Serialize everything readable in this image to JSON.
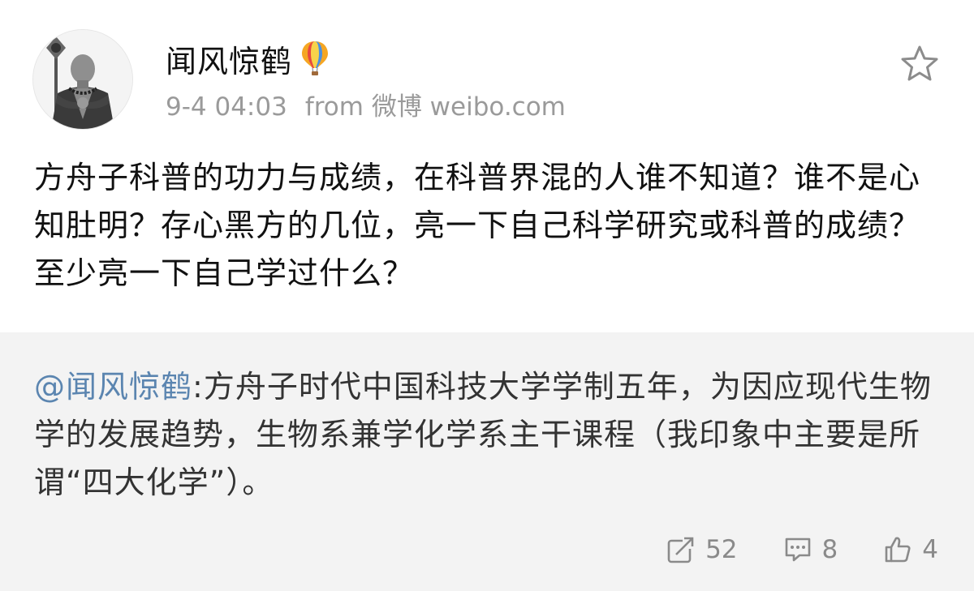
{
  "post": {
    "username": "闻风惊鹤",
    "timestamp": "9-4 04:03",
    "source": "from 微博 weibo.com",
    "text": "方舟子科普的功力与成绩，在科普界混的人谁不知道？谁不是心知肚明？存心黑方的几位，亮一下自己科学研究或科普的成绩？至少亮一下自己学过什么？",
    "badge_icon": "hot-air-balloon-icon",
    "favorite_icon": "star-icon"
  },
  "repost": {
    "mention": "@闻风惊鹤",
    "text": ":方舟子时代中国科技大学学制五年，为因应现代生物学的发展趋势，生物系兼学化学系主干课程（我印象中主要是所谓“四大化学”）。"
  },
  "actions": {
    "repost_count": "52",
    "comment_count": "8",
    "like_count": "4",
    "repost_icon": "share-icon",
    "comment_icon": "comment-icon",
    "like_icon": "thumbs-up-icon"
  },
  "colors": {
    "mention": "#5b85b0",
    "meta_text": "#9a9a9a",
    "repost_background": "#f3f3f3",
    "action_text": "#8a8a8a"
  }
}
